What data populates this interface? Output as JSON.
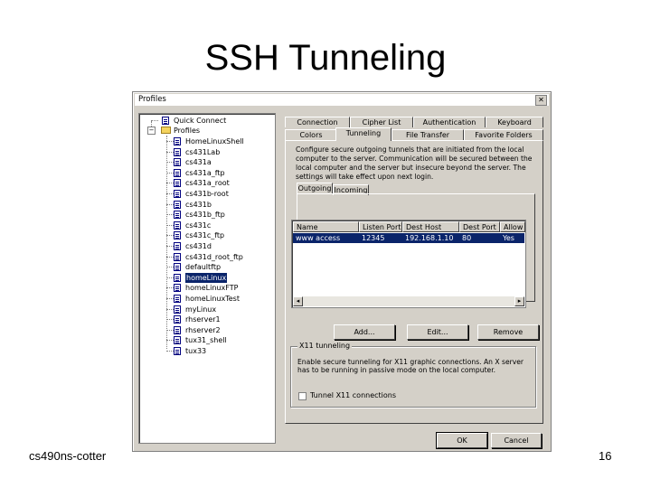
{
  "slide": {
    "title": "SSH Tunneling",
    "footer_left": "cs490ns-cotter",
    "page_number": "16"
  },
  "dialog": {
    "title": "Profiles",
    "close_glyph": "✕",
    "tree": {
      "quick_connect": "Quick Connect",
      "profiles_label": "Profiles",
      "items": [
        {
          "label": "HomeLinuxShell"
        },
        {
          "label": "cs431Lab"
        },
        {
          "label": "cs431a"
        },
        {
          "label": "cs431a_ftp"
        },
        {
          "label": "cs431a_root"
        },
        {
          "label": "cs431b-root"
        },
        {
          "label": "cs431b"
        },
        {
          "label": "cs431b_ftp"
        },
        {
          "label": "cs431c"
        },
        {
          "label": "cs431c_ftp"
        },
        {
          "label": "cs431d"
        },
        {
          "label": "cs431d_root_ftp"
        },
        {
          "label": "defaultftp"
        },
        {
          "label": "homeLinux"
        },
        {
          "label": "homeLinuxFTP"
        },
        {
          "label": "homeLinuxTest"
        },
        {
          "label": "myLinux"
        },
        {
          "label": "rhserver1"
        },
        {
          "label": "rhserver2"
        },
        {
          "label": "tux31_shell"
        },
        {
          "label": "tux33"
        }
      ],
      "selected_index": 13
    },
    "tabs_row1": [
      "Connection",
      "Cipher List",
      "Authentication",
      "Keyboard"
    ],
    "tabs_row2": [
      "Colors",
      "Tunneling",
      "File Transfer",
      "Favorite Folders"
    ],
    "active_tab": "Tunneling",
    "description": "Configure secure outgoing tunnels that are initiated from the local computer to the server. Communication will be secured between the local computer and the server but insecure beyond the server. The settings will take effect upon next login.",
    "subtabs": [
      "Outgoing",
      "Incoming"
    ],
    "list": {
      "headers": [
        "Name",
        "Listen Port",
        "Dest Host",
        "Dest Port",
        "Allow"
      ],
      "rows": [
        [
          "www access",
          "12345",
          "192.168.1.10",
          "80",
          "Yes"
        ]
      ],
      "scroll_left": "◂",
      "scroll_right": "▸"
    },
    "buttons": {
      "add": "Add...",
      "edit": "Edit...",
      "remove": "Remove",
      "ok": "OK",
      "cancel": "Cancel"
    },
    "x11": {
      "legend": "X11 tunneling",
      "description": "Enable secure tunneling for X11 graphic connections. An X server has to be running in passive mode on the local computer.",
      "checkbox_label": "Tunnel X11 connections",
      "checked": false
    }
  }
}
